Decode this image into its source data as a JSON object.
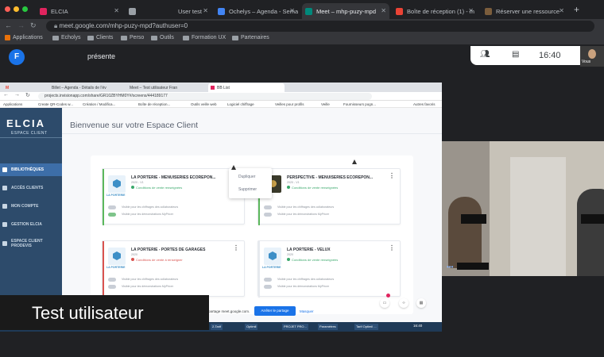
{
  "outer_browser": {
    "tabs": [
      {
        "title": "ELCIA",
        "favicon_color": "#e0245e"
      },
      {
        "title": "",
        "favicon_color": "#9aa0a6"
      },
      {
        "title": "User test",
        "favicon_color": "#9aa0a6"
      },
      {
        "title": "Ochelys – Agenda - Sema",
        "favicon_color": "#4285f4"
      },
      {
        "title": "Meet – mhp-puzy-mpd",
        "favicon_color": "#00897b"
      },
      {
        "title": "Boîte de réception (1) - m",
        "favicon_color": "#ea4335"
      },
      {
        "title": "Réserver une ressource",
        "favicon_color": "#7b5d3c"
      }
    ],
    "new_tab_symbol": "+",
    "url": "meet.google.com/mhp-puzy-mpd?authuser=0",
    "bookmarks": [
      "Applications",
      "Echolys",
      "Clients",
      "Perso",
      "Outils",
      "Formation UX",
      "Partenaires"
    ]
  },
  "meet": {
    "presenter_initial": "F",
    "presenting_label": "présente",
    "clock": "16:40",
    "self_label": "Vous",
    "caption": "Test utilisateur",
    "participants_icon": "people-icon",
    "chat_icon": "chat-icon"
  },
  "shared": {
    "tabs": [
      "Gmail",
      "Billet – Agenda - Détails de l'év",
      "Meet – Test utilisateur Fran",
      "BB List"
    ],
    "url": "projects.invisionapp.com/share/GR10ZBYHM0Y#/screens/444189177",
    "bookmarks": [
      "Applications",
      "Create QR-Codes w...",
      "Création / Modifica...",
      "Boîte de réception...",
      "Outils veille web",
      "Logiciel chiffrage",
      "Veilles pour profils",
      "Veille",
      "Fournisseurs pogn...",
      "Autres favoris"
    ],
    "app": {
      "logo": "ELCIA",
      "logo_sub": "ESPACE CLIENT",
      "welcome": "Bienvenue sur votre Espace Client",
      "nav": [
        {
          "label": "BIBLIOTHÈQUES",
          "active": true
        },
        {
          "label": "ACCÈS CLIENTS",
          "active": false
        },
        {
          "label": "MON COMPTE",
          "active": false
        },
        {
          "label": "GESTION ELCIA",
          "active": false
        },
        {
          "label": "ESPACE CLIENT",
          "label2": "PRODEVIS",
          "active": false
        }
      ],
      "cards": [
        {
          "title": "LA PORTERIE - MENUISERIES ECOREPON...",
          "date": "2020 - V1",
          "status": "Conditions de vente renseignées",
          "status_color": "#3aa86b",
          "bar_color": "#5cb85c",
          "logo_text": "LA PORTERIE",
          "toggle1": "Visible pour les chiffrages des collaborateurs",
          "toggle2": "Visible pour les démonstrations MyPricer",
          "t2_on": true
        },
        {
          "title": "PERSPECTIVE - MENUISERIES ECOREPON...",
          "date": "2020 - V1",
          "status": "Conditions de vente renseignées",
          "status_color": "#3aa86b",
          "bar_color": "#5cb85c",
          "logo_text": "",
          "toggle1": "Visible pour les chiffrages des collaborateurs",
          "toggle2": "Visible pour les démonstrations MyPricer",
          "t2_on": false
        },
        {
          "title": "LA PORTERIE - PORTES DE GARAGES",
          "date": "2020",
          "status": "Conditions de vente à renseigner",
          "status_color": "#d9534f",
          "bar_color": "#d9534f",
          "logo_text": "LA PORTERIE",
          "toggle1": "Visible pour les chiffrages des collaborateurs",
          "toggle2": "Visible pour les démonstrations MyPricer",
          "t2_on": false
        },
        {
          "title": "LA PORTERIE - VELUX",
          "date": "2020",
          "status": "Conditions de vente renseignées",
          "status_color": "#3aa86b",
          "bar_color": "#e6e9ee",
          "logo_text": "LA PORTERIE",
          "toggle1": "Visible pour les chiffrages des collaborateurs",
          "toggle2": "Visible pour les démonstrations MyPricer",
          "t2_on": false
        }
      ],
      "menu": {
        "item1": "Dupliquer",
        "item2": "Supprimer"
      }
    },
    "share_bar": {
      "text": "partage meet.google.com.",
      "stop": "Arrêter le partage",
      "hide": "Masquer"
    },
    "taskbar": [
      "2-Tarif",
      "Optimil",
      "PROJET PRO...",
      "Paramètres",
      "Tarif Optimil ..."
    ],
    "taskbar_clock": "16:40"
  }
}
